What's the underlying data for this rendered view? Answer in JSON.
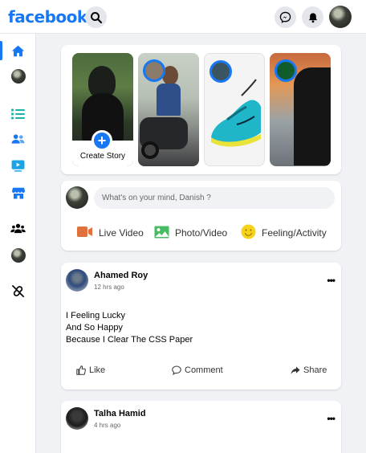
{
  "brand": {
    "logo_text": "facebook",
    "accent": "#1877f2"
  },
  "topbar": {
    "icons": [
      "search-icon",
      "messenger-icon",
      "bell-icon",
      "profile-avatar"
    ]
  },
  "sidebar": {
    "items": [
      "home-icon",
      "profile-avatar",
      "list-icon",
      "friends-icon",
      "watch-icon",
      "marketplace-icon",
      "groups-icon",
      "profile-avatar",
      "unlink-icon"
    ]
  },
  "stories": {
    "create_label": "Create Story",
    "plus": "+"
  },
  "composer": {
    "placeholder": "What's on your mind, Danish ?",
    "actions": [
      {
        "label": "Live Video",
        "icon": "video-camera-icon",
        "color": "#e0703c"
      },
      {
        "label": "Photo/Video",
        "icon": "photo-icon",
        "color": "#45bd62"
      },
      {
        "label": "Feeling/Activity",
        "icon": "smiley-icon",
        "color": "#f7d21a"
      }
    ]
  },
  "posts": [
    {
      "author": "Ahamed Roy",
      "time": "12 hrs ago",
      "lines": [
        "I Feeling Lucky",
        "And So Happy",
        "Because I Clear The CSS Paper"
      ],
      "like": "Like",
      "comment": "Comment",
      "share": "Share",
      "more": "•••"
    },
    {
      "author": "Talha Hamid",
      "time": "4 hrs ago",
      "more": "•••"
    }
  ]
}
